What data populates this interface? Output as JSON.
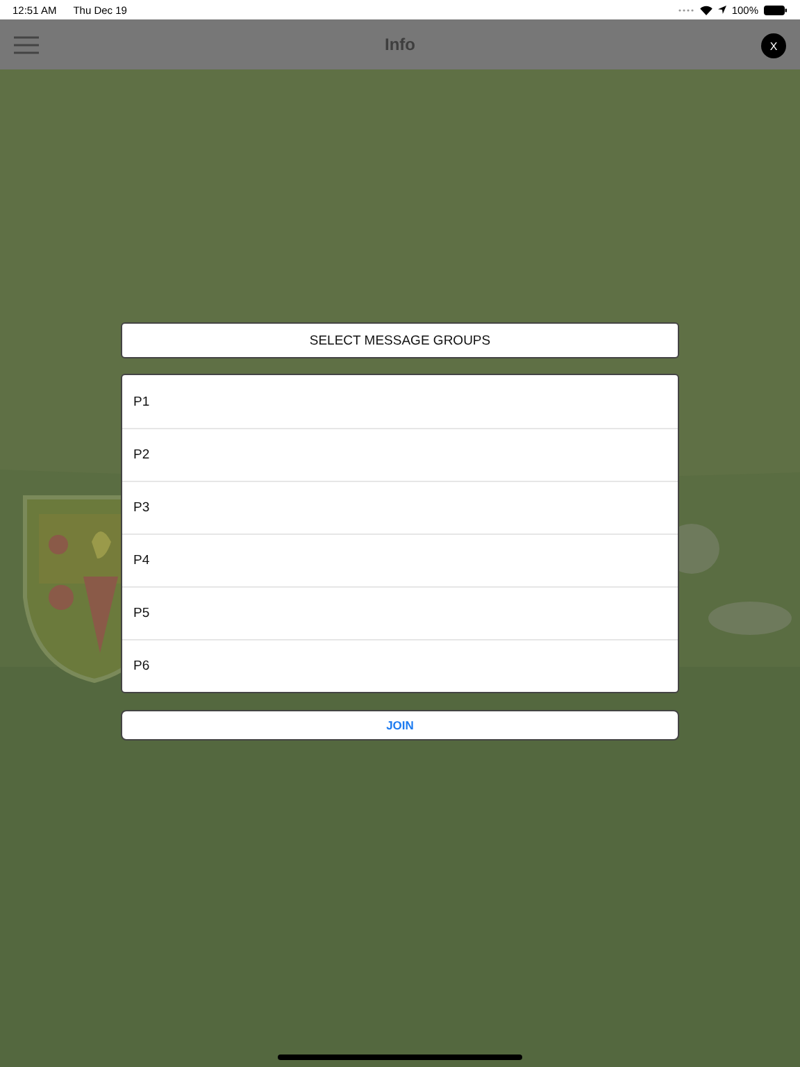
{
  "status_bar": {
    "time": "12:51 AM",
    "date": "Thu Dec 19",
    "battery": "100%"
  },
  "nav_bar": {
    "title": "Info",
    "close": "X"
  },
  "dialog": {
    "title": "SELECT MESSAGE GROUPS",
    "groups": [
      {
        "label": "P1"
      },
      {
        "label": "P2"
      },
      {
        "label": "P3"
      },
      {
        "label": "P4"
      },
      {
        "label": "P5"
      },
      {
        "label": "P6"
      }
    ],
    "button": "JOIN"
  }
}
